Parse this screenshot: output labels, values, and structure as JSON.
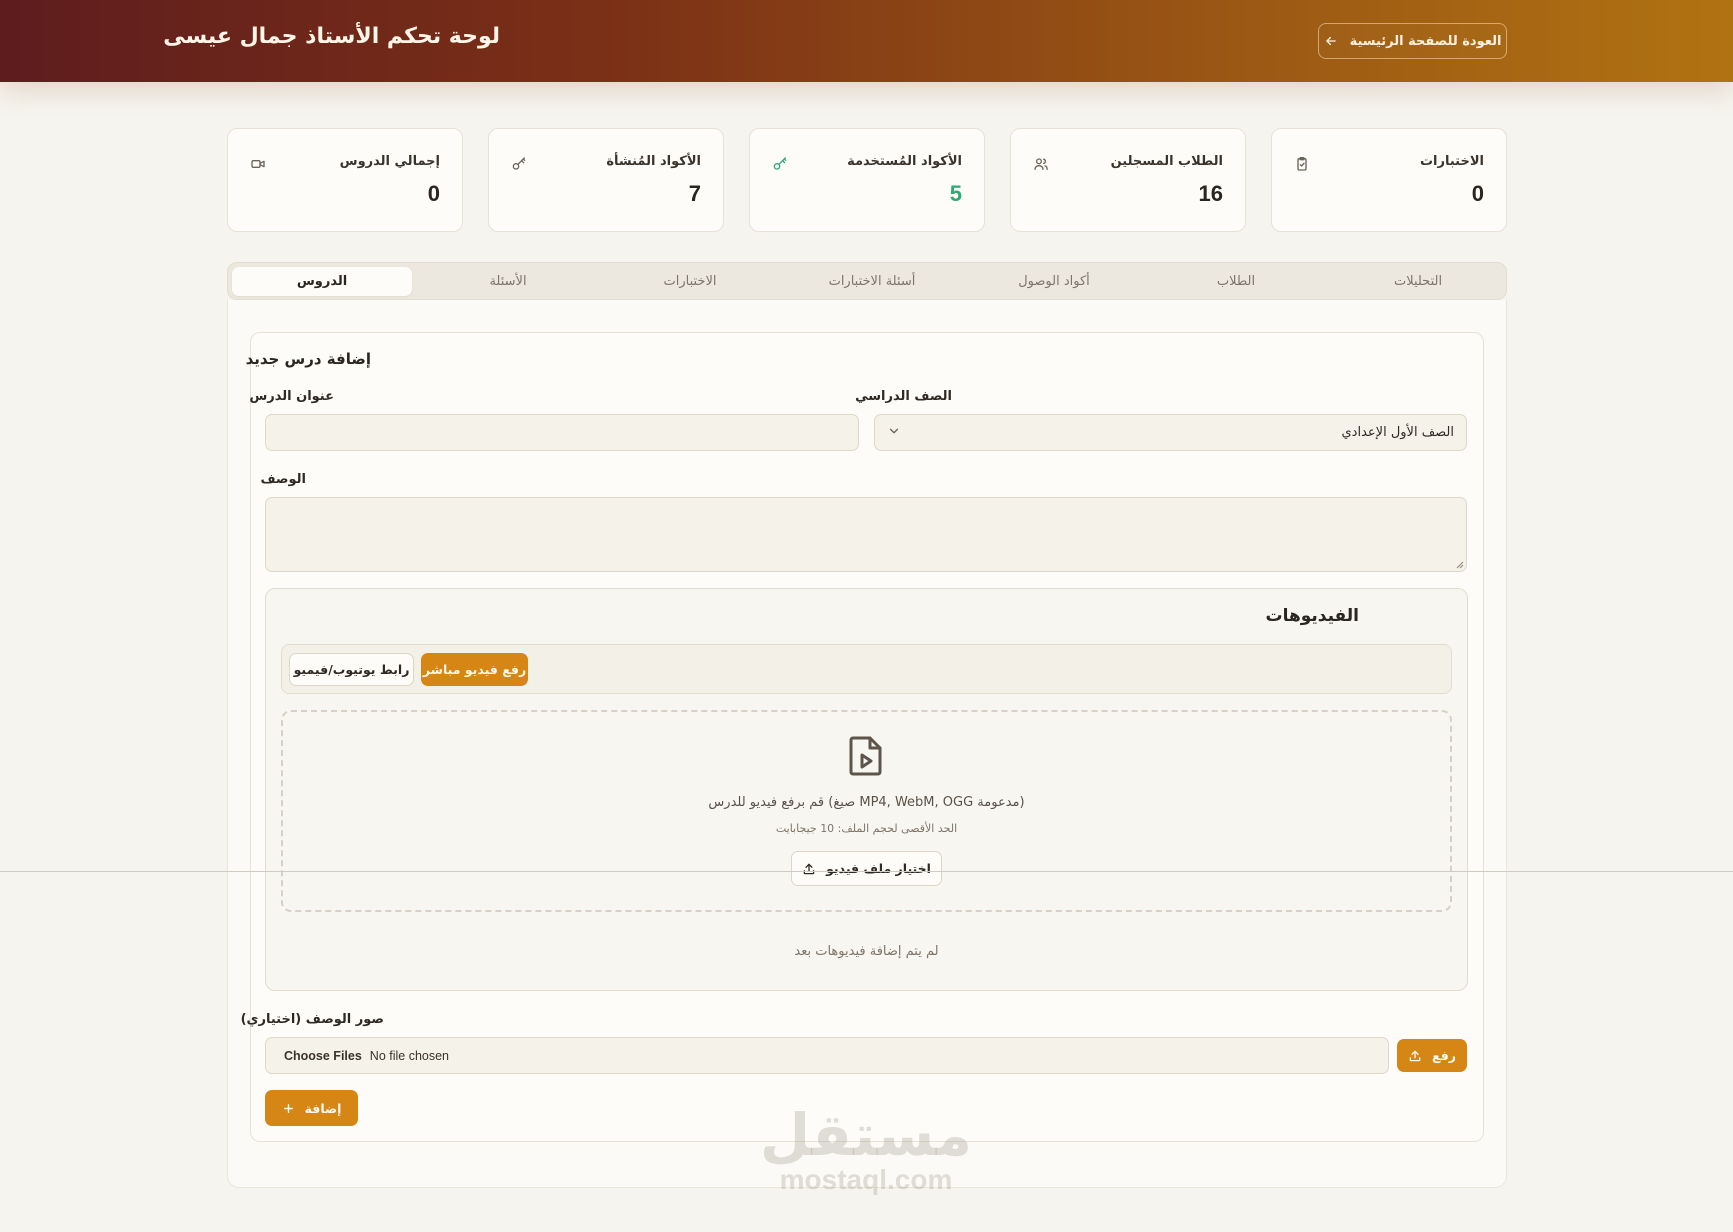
{
  "header": {
    "title": "لوحة تحكم الأستاذ جمال عيسى",
    "back_label": "العودة للصفحة الرئيسية"
  },
  "stats": [
    {
      "label": "الاختبارات",
      "value": "0",
      "icon": "clipboard-check-icon"
    },
    {
      "label": "الطلاب المسجلين",
      "value": "16",
      "icon": "users-icon"
    },
    {
      "label": "الأكواد المُستخدمة",
      "value": "5",
      "icon": "key-icon",
      "color": "#2fa877"
    },
    {
      "label": "الأكواد المُنشأة",
      "value": "7",
      "icon": "key-icon"
    },
    {
      "label": "إجمالي الدروس",
      "value": "0",
      "icon": "video-icon"
    }
  ],
  "tabs": [
    {
      "label": "التحليلات"
    },
    {
      "label": "الطلاب"
    },
    {
      "label": "أكواد الوصول"
    },
    {
      "label": "أسئلة الاختبارات"
    },
    {
      "label": "الاختبارات"
    },
    {
      "label": "الأسئلة"
    },
    {
      "label": "الدروس",
      "active": true
    }
  ],
  "form": {
    "title": "إضافة درس جديد",
    "grade_label": "الصف الدراسي",
    "grade_value": "الصف الأول الإعدادي",
    "lesson_title_label": "عنوان الدرس",
    "lesson_title_value": "",
    "description_label": "الوصف",
    "description_value": "",
    "videos": {
      "title": "الفيديوهات",
      "upload_direct_label": "رفع فيديو مباشر",
      "youtube_link_label": "رابط يوتيوب/فيميو",
      "drop_main_text": "(مدعومة MP4, WebM, OGG صيغ) قم برفع فيديو للدرس",
      "drop_sub_text": "الحد الأقصى لحجم الملف: 10 جيجابايت",
      "choose_video_label": "اختيار ملف فيديو",
      "empty_text": "لم يتم إضافة فيديوهات بعد"
    },
    "images_label": "صور الوصف (اختياري)",
    "file_button_label": "Choose Files",
    "file_status": "No file chosen",
    "upload_label": "رفع",
    "add_label": "إضافة"
  },
  "colors": {
    "accent": "#d68614",
    "header_start": "#b07312",
    "header_end": "#5e1c1e",
    "success": "#2fa877"
  },
  "watermark": {
    "arabic": "مستقل",
    "latin": "mostaql.com"
  }
}
